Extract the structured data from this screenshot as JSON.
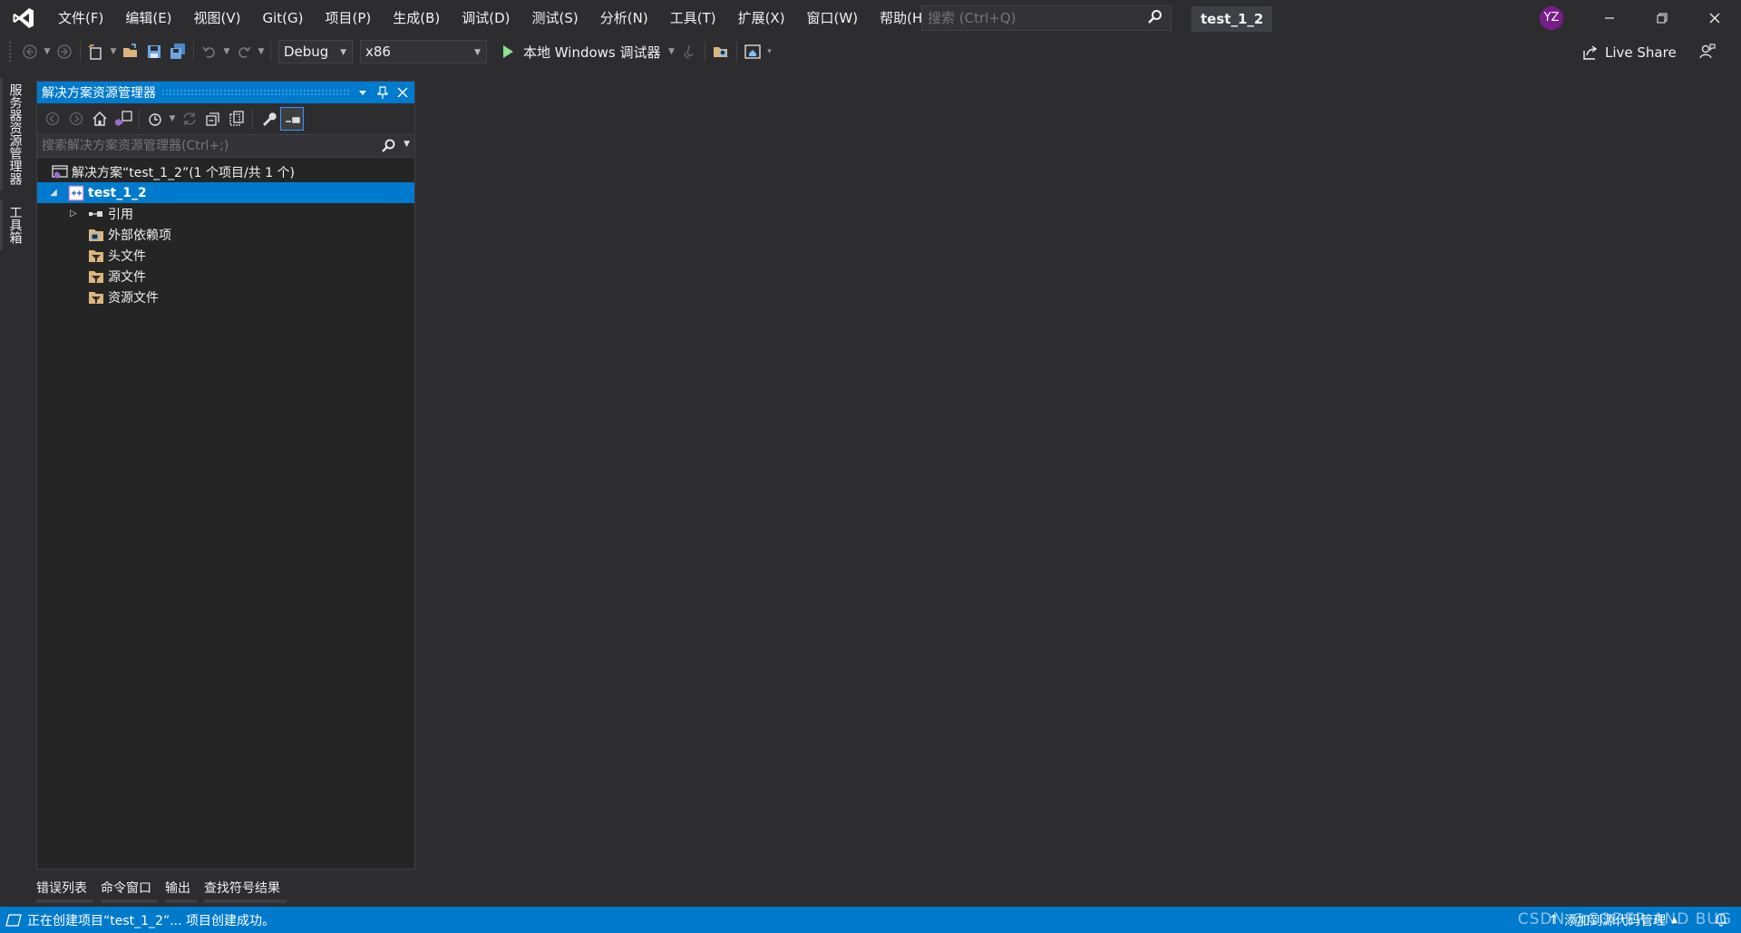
{
  "menu": [
    "文件(F)",
    "编辑(E)",
    "视图(V)",
    "Git(G)",
    "项目(P)",
    "生成(B)",
    "调试(D)",
    "测试(S)",
    "分析(N)",
    "工具(T)",
    "扩展(X)",
    "窗口(W)",
    "帮助(H)"
  ],
  "search": {
    "placeholder": "搜索 (Ctrl+Q)"
  },
  "solution_badge": "test_1_2",
  "user_initials": "YZ",
  "toolbar": {
    "config": "Debug",
    "platform": "x86",
    "run_label": "本地 Windows 调试器",
    "live_share": "Live Share"
  },
  "side_tabs": [
    "服务器资源管理器",
    "工具箱"
  ],
  "solution_explorer": {
    "title": "解决方案资源管理器",
    "search_placeholder": "搜索解决方案资源管理器(Ctrl+;)",
    "tree": {
      "solution": "解决方案“test_1_2”(1 个项目/共 1 个)",
      "project": "test_1_2",
      "items": [
        "引用",
        "外部依赖项",
        "头文件",
        "源文件",
        "资源文件"
      ]
    }
  },
  "bottom_tabs": [
    "错误列表",
    "命令窗口",
    "输出",
    "查找符号结果"
  ],
  "status": {
    "message": "正在创建项目“test_1_2”... 项目创建成功。",
    "source_control": "添加到源代码管理",
    "watermark": "CSDN @CODER AND BUG"
  },
  "colors": {
    "accent": "#007acc",
    "vs_purple": "#7a1d8c",
    "run_green": "#8ae28a",
    "folder": "#dcb67a"
  }
}
